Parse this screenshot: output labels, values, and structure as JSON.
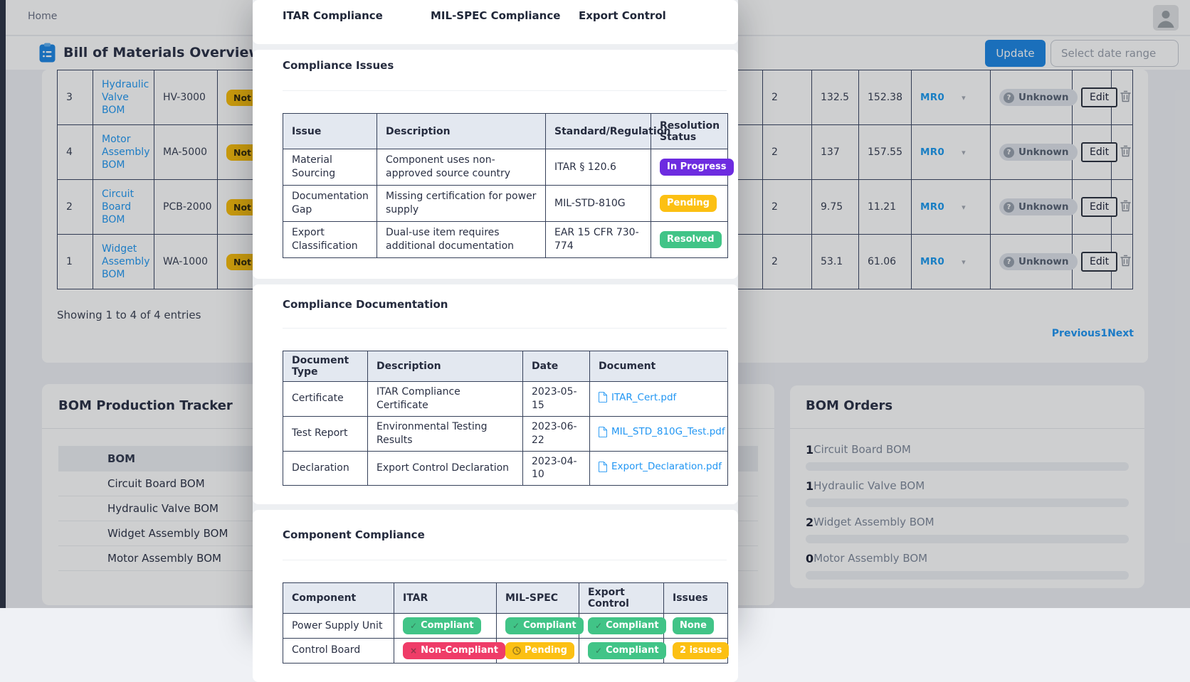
{
  "colors": {
    "accent_blue": "#1e88e5",
    "link_blue": "#2196f3",
    "badge_purple": "#6d2ce0",
    "badge_yellow": "#fcc013",
    "badge_green": "#41c487",
    "badge_red": "#ef3c68",
    "badge_warning": "#fabe0c",
    "dot_green": "#24b355",
    "dot_purple": "#5e36dc",
    "dot_yellow": "#f7b910",
    "dot_red": "#e44867"
  },
  "header": {
    "breadcrumb": "Home"
  },
  "toolbar": {
    "title": "Bill of Materials Overview",
    "update_label": "Update",
    "date_placeholder": "Select date range"
  },
  "bom_table": {
    "edit_label": "Edit",
    "rows": [
      {
        "num": "3",
        "name": "Hydraulic Valve BOM",
        "part": "HV-3000",
        "status": "Not Started",
        "qty": "2",
        "unit_cost": "132.5",
        "total_cost": "152.38",
        "rev": "MR0",
        "state": "Unknown"
      },
      {
        "num": "4",
        "name": "Motor Assembly BOM",
        "part": "MA-5000",
        "status": "Not Started",
        "qty": "2",
        "unit_cost": "137",
        "total_cost": "157.55",
        "rev": "MR0",
        "state": "Unknown"
      },
      {
        "num": "2",
        "name": "Circuit Board BOM",
        "part": "PCB-2000",
        "status": "Not Started",
        "qty": "2",
        "unit_cost": "9.75",
        "total_cost": "11.21",
        "rev": "MR0",
        "state": "Unknown"
      },
      {
        "num": "1",
        "name": "Widget Assembly BOM",
        "part": "WA-1000",
        "status": "Not Started",
        "qty": "2",
        "unit_cost": "53.1",
        "total_cost": "61.06",
        "rev": "MR0",
        "state": "Unknown"
      }
    ],
    "footer": "Showing 1 to 4 of 4 entries",
    "pagination": {
      "prev": "Previous",
      "page": "1",
      "next": "Next"
    }
  },
  "modal": {
    "top_labels": [
      "ITAR Compliance",
      "MIL-SPEC Compliance",
      "Export Control"
    ],
    "issues": {
      "title": "Compliance Issues",
      "headers": [
        "Issue",
        "Description",
        "Standard/Regulation",
        "Resolution Status"
      ],
      "rows": [
        {
          "issue": "Material Sourcing",
          "description": "Component uses non-approved source country",
          "standard": "ITAR § 120.6",
          "status": "In Progress"
        },
        {
          "issue": "Documentation Gap",
          "description": "Missing certification for power supply",
          "standard": "MIL-STD-810G",
          "status": "Pending"
        },
        {
          "issue": "Export Classification",
          "description": "Dual-use item requires additional documentation",
          "standard": "EAR 15 CFR 730-774",
          "status": "Resolved"
        }
      ]
    },
    "documents": {
      "title": "Compliance Documentation",
      "headers": [
        "Document Type",
        "Description",
        "Date",
        "Document"
      ],
      "rows": [
        {
          "type": "Certificate",
          "description": "ITAR Compliance Certificate",
          "date": "2023-05-15",
          "file": "ITAR_Cert.pdf"
        },
        {
          "type": "Test Report",
          "description": "Environmental Testing Results",
          "date": "2023-06-22",
          "file": "MIL_STD_810G_Test.pdf"
        },
        {
          "type": "Declaration",
          "description": "Export Control Declaration",
          "date": "2023-04-10",
          "file": "Export_Declaration.pdf"
        }
      ]
    },
    "components": {
      "title": "Component Compliance",
      "headers": [
        "Component",
        "ITAR",
        "MIL-SPEC",
        "Export Control",
        "Issues"
      ],
      "rows": [
        {
          "component": "Power Supply Unit",
          "itar": "Compliant",
          "milspec": "Compliant",
          "export": "Compliant",
          "issues": "None"
        },
        {
          "component": "Control Board",
          "itar": "Non-Compliant",
          "milspec": "Pending",
          "export": "Compliant",
          "issues": "2 issues"
        }
      ]
    }
  },
  "tracker": {
    "title": "BOM Production Tracker",
    "bom_column": "BOM",
    "rows": [
      {
        "name": "Circuit Board BOM",
        "dot_color": "#24b355"
      },
      {
        "name": "Hydraulic Valve BOM",
        "dot_color": "#5e36dc"
      },
      {
        "name": "Widget Assembly BOM",
        "dot_color": "#f7b910"
      },
      {
        "name": "Motor Assembly BOM",
        "dot_color": "#e44867"
      }
    ]
  },
  "orders": {
    "title": "BOM Orders",
    "items": [
      {
        "count": "1",
        "name": "Circuit Board BOM"
      },
      {
        "count": "1",
        "name": "Hydraulic Valve BOM"
      },
      {
        "count": "2",
        "name": "Widget Assembly BOM"
      },
      {
        "count": "0",
        "name": "Motor Assembly BOM"
      }
    ]
  }
}
